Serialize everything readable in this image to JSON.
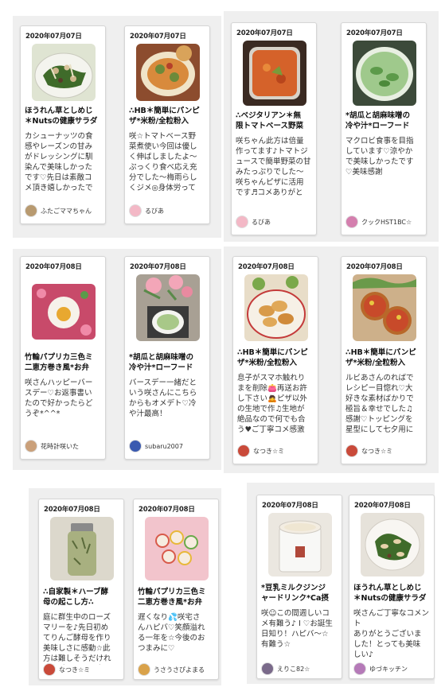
{
  "cards": [
    {
      "date": "2020年07月07日",
      "title": "ほうれん草としめじ\n＊Nutsの健康サラダ",
      "desc": "カシューナッツの食\n感やレーズンの甘み\nがドレッシングに馴\n染んで美味しかった\nです♡先日は素敵コ\nメ頂き嬉しかったで",
      "user": "ふたごママちゃん",
      "avatar_color": "#b89a70",
      "thumb": "salad"
    },
    {
      "date": "2020年07月07日",
      "title": "∴HB＊簡単にパンピ\nザ*米粉/全粒粉入",
      "desc": "咲☆トマトベース野\n菜煮使い今回は優し\nく伸ばしましたよ〜\nぷっくり食べ応え充\n分でした〜梅雨らし\nくジメ◎身体労って",
      "user": "るびあ",
      "avatar_color": "#f3b8c6",
      "thumb": "pizza"
    },
    {
      "date": "2020年07月07日",
      "title": "∴ベジタリアン＊無\n限トマトベース野菜",
      "desc": "咲ちゃん此方は倍量\n作ってます♪トマトジ\nュースで簡単野菜の甘\nみたっぷりでした〜\n咲ちゃんピザに活用\nです♬コメありがと",
      "user": "るびあ",
      "avatar_color": "#f3b8c6",
      "thumb": "tomato"
    },
    {
      "date": "2020年07月07日",
      "title": "*胡瓜と胡麻味噌の\n冷や汁*ローフード",
      "desc": "マクロビ食事を目指\nしています♡涼やか\nで美味しかったです\n♡美味感謝",
      "user": "クックHST1BC☆",
      "avatar_color": "#d47fae",
      "thumb": "cucumber"
    },
    {
      "date": "2020年07月08日",
      "title": "竹輪パプリカ三色ミ\n二恵方巻き風*お弁",
      "desc": "咲さんハッピーバー\nスデー♡お返事書い\nたので好かったらど\nうぞ*^^*",
      "user": "花時計咲いた",
      "avatar_color": "#caa07a",
      "thumb": "egg"
    },
    {
      "date": "2020年07月08日",
      "title": "*胡瓜と胡麻味噌の\n冷や汁*ローフード",
      "desc": "バースデー一緒だと\nいう咲さんにこちら\nからもオメデト♡冷\nや汁最高！",
      "user": "subaru2007",
      "avatar_color": "#3a5ab0",
      "thumb": "rose"
    },
    {
      "date": "2020年07月08日",
      "title": "∴HB＊簡単にパンピ\nザ*米粉/全粒粉入",
      "desc": "息子がスマホ触れり\nまを削除👛再送お許\nし下さい🙇ピザ以外\nの生地で作♫生地が\n絶品なので何でも合\nう♥ご丁寧コメ感激",
      "user": "なつき☆ミ",
      "avatar_color": "#c94a3a",
      "thumb": "bread"
    },
    {
      "date": "2020年07月08日",
      "title": "∴HB＊簡単にパンピ\nザ*米粉/全粒粉入",
      "desc": "ルビあさんのればで\nレシピー目惚れ♡大\n好きな素材ばかりで\n極旨＆幸せでした♫\n感謝♡トッピングを\n星型にして七夕用に",
      "user": "なつき☆ミ",
      "avatar_color": "#c94a3a",
      "thumb": "star"
    },
    {
      "date": "2020年07月08日",
      "title": "∴自家製＊ハーブ酵\n母の起こし方∴",
      "desc": "庭に群生中のローズ\nマリーを♪先日初め\nてりんご酵母を作り\n美味しさに感動☆此\n方は難しそうだけれ\nど上手くいくと良い",
      "user": "なつき☆ミ",
      "avatar_color": "#c94a3a",
      "thumb": "jar"
    },
    {
      "date": "2020年07月08日",
      "title": "竹輪パプリカ三色ミ\n二恵方巻き風*お弁",
      "desc": "遅くなり💦咲宅さ\nんハピバ♡笑顔溢れ\nる一年を☆今後のお\nつまみに♡",
      "user": "うさうさぴよまる",
      "avatar_color": "#d9a24a",
      "thumb": "rolls"
    },
    {
      "date": "2020年07月08日",
      "title": "*豆乳ミルクジンジ\nャードリンク*Ca摂",
      "desc": "咲☺この間週しいコ\nメ有難う♪ I ♡お誕生\n日知り！ハピバ〜☆\n有難う☆",
      "user": "えりこ82☆",
      "avatar_color": "#7a6a8a",
      "thumb": "cup"
    },
    {
      "date": "2020年07月08日",
      "title": "ほうれん草としめじ\n＊Nutsの健康サラダ",
      "desc": "咲さんご丁寧なコメント\nありがとうございま\nした！とっても美味\nしい♪",
      "user": "ゆづキッチン",
      "avatar_color": "#b57ab8",
      "thumb": "salad2"
    }
  ]
}
